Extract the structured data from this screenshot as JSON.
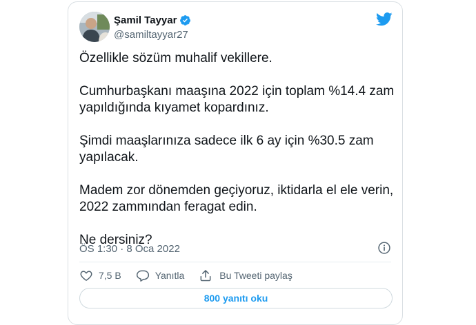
{
  "author": {
    "name": "Şamil Tayyar",
    "handle": "@samiltayyar27",
    "verified": true
  },
  "tweet": {
    "text": "Özellikle sözüm muhalif vekillere.\n\nCumhurbaşkanı maaşına 2022 için toplam %14.4 zam yapıldığında kıyamet kopardınız.\n\nŞimdi maaşlarınıza sadece ilk 6 ay için %30.5 zam yapılacak.\n\nMadem zor dönemden geçiyoruz, iktidarla el ele verin, 2022 zammından feragat edin.\n\nNe dersiniz?",
    "timestamp": "ÖS 1:30 · 8 Oca 2022"
  },
  "actions": {
    "like_count": "7,5 B",
    "reply_label": "Yanıtla",
    "share_label": "Bu Tweeti paylaş"
  },
  "read_replies_label": "800 yanıtı oku",
  "colors": {
    "accent": "#1d9bf0",
    "text": "#0f1419",
    "secondary": "#536471"
  },
  "icons": {
    "brand": "twitter-bird-icon",
    "verified": "verified-badge-icon",
    "info": "info-icon",
    "like": "heart-icon",
    "reply": "speech-bubble-icon",
    "share": "share-arrow-icon"
  }
}
